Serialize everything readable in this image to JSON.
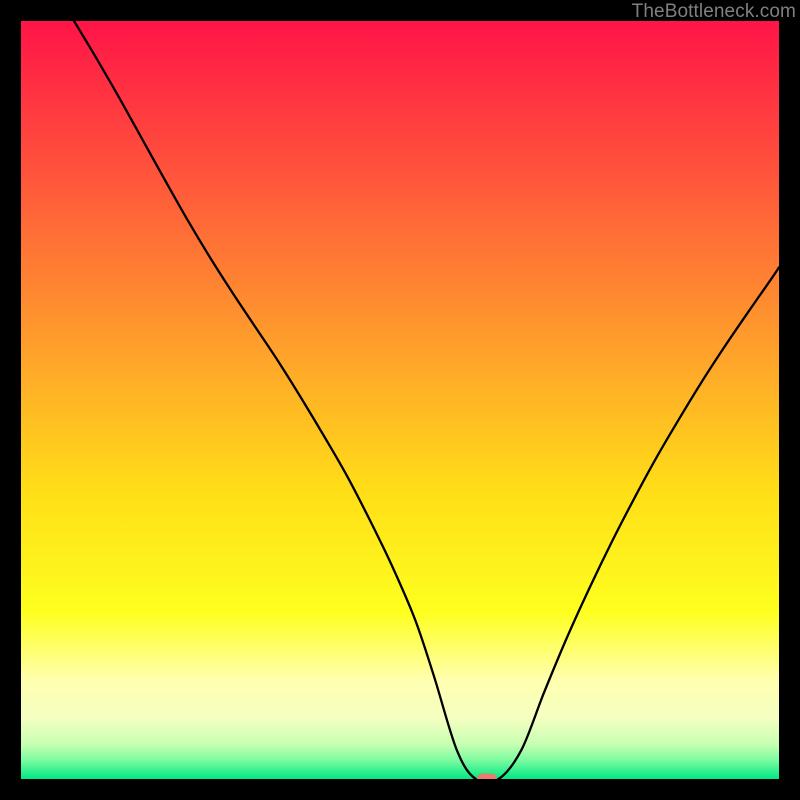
{
  "watermark": "TheBottleneck.com",
  "marker_color": "#e77d6d",
  "chart_data": {
    "type": "line",
    "title": "",
    "xlabel": "",
    "ylabel": "",
    "xlim": [
      0,
      100
    ],
    "ylim": [
      0,
      100
    ],
    "grid": false,
    "series": [
      {
        "name": "curve",
        "color": "#000000",
        "x": [
          7,
          10,
          13,
          16,
          19,
          22,
          25,
          28,
          31,
          34,
          37,
          40,
          43,
          46,
          49,
          52,
          54.5,
          57.5,
          60,
          63,
          66,
          69,
          72,
          75,
          78,
          81,
          84,
          87,
          90,
          93,
          96,
          99,
          100
        ],
        "y": [
          100,
          95,
          89.8,
          84.4,
          79,
          73.7,
          68.7,
          64,
          59.5,
          55,
          50.2,
          45.2,
          40,
          34.2,
          28,
          21,
          13.5,
          3.8,
          0,
          0,
          3.8,
          11.4,
          18.6,
          25.2,
          31.4,
          37.2,
          42.7,
          47.8,
          52.7,
          57.3,
          61.7,
          66,
          67.5
        ]
      }
    ],
    "marker": {
      "x": 61.5,
      "y": 0
    },
    "background_gradient": {
      "stops": [
        {
          "p": 0,
          "c": "#ff1447"
        },
        {
          "p": 22,
          "c": "#ff5a3a"
        },
        {
          "p": 45,
          "c": "#ffa62a"
        },
        {
          "p": 62,
          "c": "#ffde17"
        },
        {
          "p": 78,
          "c": "#feff1f"
        },
        {
          "p": 87,
          "c": "#ffffb0"
        },
        {
          "p": 92,
          "c": "#f4ffc0"
        },
        {
          "p": 95.5,
          "c": "#c5ffb2"
        },
        {
          "p": 97.5,
          "c": "#7cfca0"
        },
        {
          "p": 100,
          "c": "#00e884"
        }
      ]
    }
  }
}
